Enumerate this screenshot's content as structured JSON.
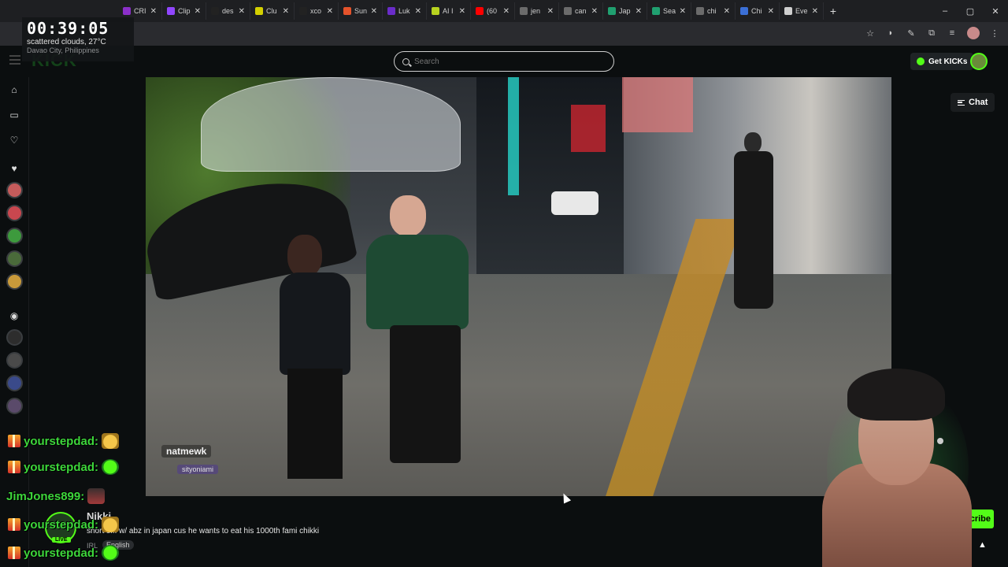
{
  "browser": {
    "tabs": [
      {
        "label": "CRI",
        "color": "#8b2fc9"
      },
      {
        "label": "Clip",
        "color": "#9146ff"
      },
      {
        "label": "des",
        "color": "#222222"
      },
      {
        "label": "Clu",
        "color": "#d4d000"
      },
      {
        "label": "xco",
        "color": "#222222"
      },
      {
        "label": "Sun",
        "color": "#e5532b"
      },
      {
        "label": "Luk",
        "color": "#6a2cc9"
      },
      {
        "label": "AI I",
        "color": "#b7d21f"
      },
      {
        "label": "(60",
        "color": "#ff0000"
      },
      {
        "label": "jen",
        "color": "#6b6b6b"
      },
      {
        "label": "can",
        "color": "#6b6b6b"
      },
      {
        "label": "Jap",
        "color": "#20a070"
      },
      {
        "label": "Sea",
        "color": "#20a070"
      },
      {
        "label": "chi",
        "color": "#6b6b6b"
      },
      {
        "label": "Chi",
        "color": "#3b6fd6"
      },
      {
        "label": "Eve",
        "color": "#cfcfcf"
      }
    ],
    "new_tab": "+",
    "window_controls": [
      "–",
      "▢",
      "✕"
    ]
  },
  "overlay": {
    "timer": "00:39:05",
    "weather": "scattered clouds, 27°C",
    "location": "Davao City, Philippines"
  },
  "header": {
    "logo": "KICK",
    "search_placeholder": "Search",
    "get_kicks": "Get KICKs"
  },
  "chat_toggle": {
    "label": "Chat"
  },
  "video": {
    "watermark": "natmewk",
    "watermark2": "sityoniami"
  },
  "stream": {
    "streamer": "Nikki",
    "live": "LIVE",
    "title": "short s... w/ abz in japan cus he wants to eat his 1000th fami chikki",
    "category": "IRL",
    "language": "English",
    "subscribe": "scribe"
  },
  "chat": [
    {
      "user": "yourstepdad:",
      "gift": true,
      "emote": "face"
    },
    {
      "user": "yourstepdad:",
      "gift": true,
      "emote": "kick"
    },
    {
      "user": "JimJones899:",
      "gift": false,
      "emote": "man"
    },
    {
      "user": "yourstepdad:",
      "gift": true,
      "emote": "face"
    },
    {
      "user": "yourstepdad:",
      "gift": true,
      "emote": "kick"
    }
  ]
}
